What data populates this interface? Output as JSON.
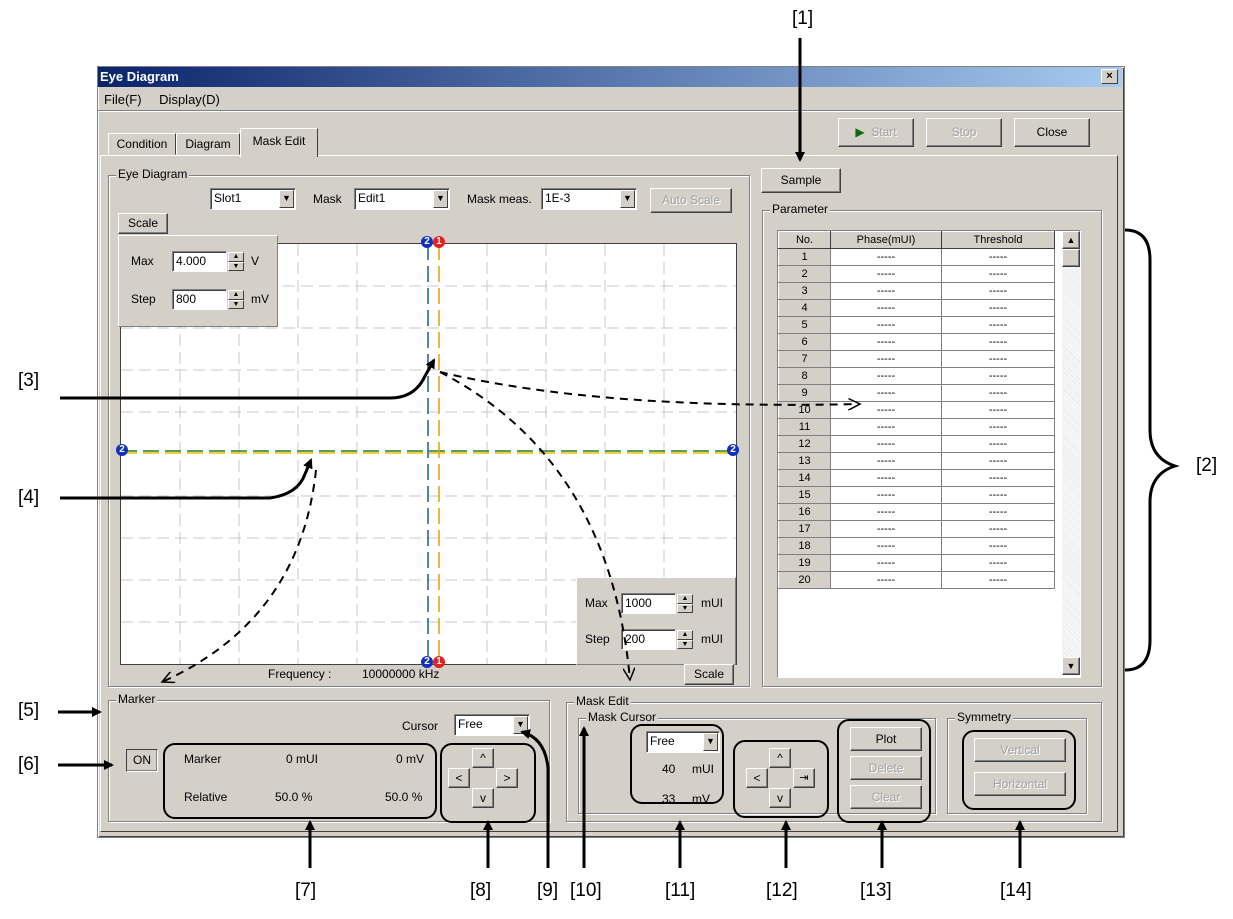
{
  "window": {
    "title": "Eye Diagram",
    "close_glyph": "×"
  },
  "menu": [
    {
      "label": "File(F)"
    },
    {
      "label": "Display(D)"
    }
  ],
  "tabs": [
    {
      "label": "Condition"
    },
    {
      "label": "Diagram"
    },
    {
      "label": "Mask Edit"
    }
  ],
  "toolbar": {
    "start": "Start",
    "stop": "Stop",
    "close": "Close"
  },
  "sample_button": "Sample",
  "eye_group": {
    "label": "Eye Diagram",
    "slot": "Slot1",
    "mask_label": "Mask",
    "mask": "Edit1",
    "mask_meas_label": "Mask meas.",
    "mask_meas": "1E-3",
    "auto_scale": "Auto Scale",
    "scale_tab": "Scale",
    "v_max_label": "Max",
    "v_max": "4.000",
    "v_max_unit": "V",
    "v_step_label": "Step",
    "v_step": "800",
    "v_step_unit": "mV",
    "h_max_label": "Max",
    "h_max": "1000",
    "h_max_unit": "mUI",
    "h_step_label": "Step",
    "h_step": "200",
    "h_step_unit": "mUI",
    "scale_bottom": "Scale",
    "frequency_label": "Frequency :",
    "frequency": "10000000 kHz",
    "marker_badges": {
      "one": "1",
      "two": "2"
    }
  },
  "parameter": {
    "label": "Parameter",
    "headers": [
      "No.",
      "Phase(mUI)",
      "Threshold"
    ],
    "rows": [
      [
        "1",
        "-----",
        "-----"
      ],
      [
        "2",
        "-----",
        "-----"
      ],
      [
        "3",
        "-----",
        "-----"
      ],
      [
        "4",
        "-----",
        "-----"
      ],
      [
        "5",
        "-----",
        "-----"
      ],
      [
        "6",
        "-----",
        "-----"
      ],
      [
        "7",
        "-----",
        "-----"
      ],
      [
        "8",
        "-----",
        "-----"
      ],
      [
        "9",
        "-----",
        "-----"
      ],
      [
        "10",
        "-----",
        "-----"
      ],
      [
        "11",
        "-----",
        "-----"
      ],
      [
        "12",
        "-----",
        "-----"
      ],
      [
        "13",
        "-----",
        "-----"
      ],
      [
        "14",
        "-----",
        "-----"
      ],
      [
        "15",
        "-----",
        "-----"
      ],
      [
        "16",
        "-----",
        "-----"
      ],
      [
        "17",
        "-----",
        "-----"
      ],
      [
        "18",
        "-----",
        "-----"
      ],
      [
        "19",
        "-----",
        "-----"
      ],
      [
        "20",
        "-----",
        "-----"
      ]
    ]
  },
  "marker": {
    "label": "Marker",
    "on_button": "ON",
    "cursor_label": "Cursor",
    "cursor_value": "Free",
    "marker_label": "Marker",
    "marker_x": "0 mUI",
    "marker_y": "0 mV",
    "relative_label": "Relative",
    "relative_x": "50.0 %",
    "relative_y": "50.0 %",
    "arrows": {
      "up": "^",
      "down": "v",
      "left": "<",
      "right": ">"
    }
  },
  "mask_edit": {
    "label": "Mask Edit",
    "cursor_group": "Mask Cursor",
    "cursor_mode": "Free",
    "x_value": "40",
    "x_unit": "mUI",
    "y_value": "33",
    "y_unit": "mV",
    "arrows": {
      "up": "^",
      "down": "v",
      "left": "<",
      "right": "⇥"
    },
    "plot": "Plot",
    "delete": "Delete",
    "clear": "Clear",
    "symmetry_label": "Symmetry",
    "vertical": "Vertical",
    "horizontal": "Horizontal"
  },
  "callouts": {
    "c1": "[1]",
    "c2": "[2]",
    "c3": "[3]",
    "c4": "[4]",
    "c5": "[5]",
    "c6": "[6]",
    "c7": "[7]",
    "c8": "[8]",
    "c9": "[9]",
    "c10": "[10]",
    "c11": "[11]",
    "c12": "[12]",
    "c13": "[13]",
    "c14": "[14]"
  },
  "colors": {
    "title_start": "#0a246a",
    "title_end": "#a6caf0",
    "marker1": "#e62020",
    "marker2": "#1030c0",
    "yellow_line": "#e8c000",
    "dialog": "#d4d0c8"
  }
}
